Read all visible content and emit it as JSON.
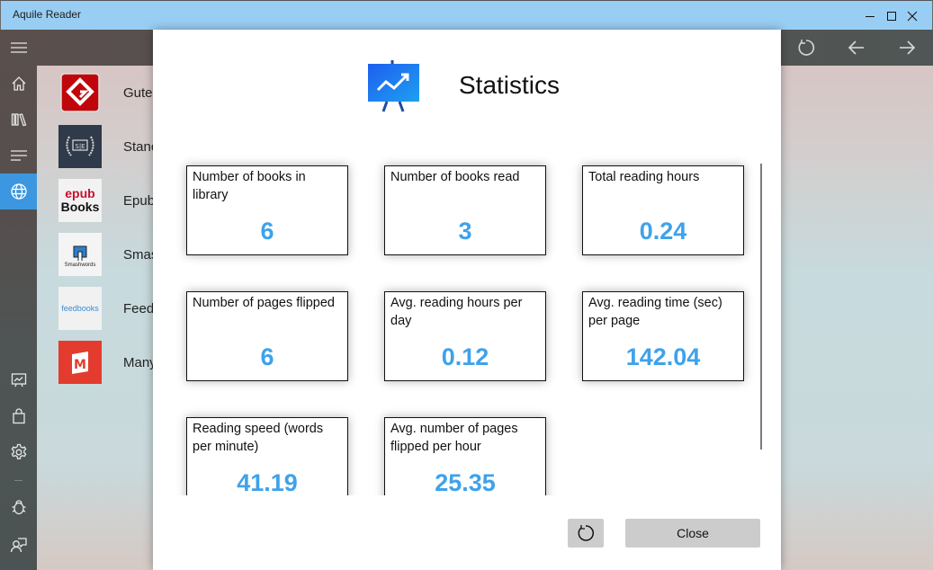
{
  "window": {
    "title": "Aquile Reader",
    "controls": {
      "minimize": "minimize-icon",
      "maximize": "maximize-icon",
      "close": "close-icon"
    }
  },
  "topbar": {
    "buttons": [
      {
        "icon": "refresh-icon"
      },
      {
        "icon": "arrow-left-icon"
      },
      {
        "icon": "arrow-right-icon"
      }
    ]
  },
  "sidebar": {
    "items": [
      {
        "icon": "hamburger-menu-icon"
      },
      {
        "icon": "home-icon"
      },
      {
        "icon": "library-icon"
      },
      {
        "icon": "list-icon"
      },
      {
        "icon": "globe-icon",
        "active": true
      },
      {
        "icon": "statistics-icon"
      },
      {
        "icon": "store-bag-icon"
      },
      {
        "icon": "gear-icon"
      },
      {
        "icon": "bug-icon"
      },
      {
        "icon": "feedback-icon"
      }
    ]
  },
  "catalogs": [
    {
      "name": "Gutenberg",
      "visible_text": "Gute",
      "logo": "gutenberg-logo"
    },
    {
      "name": "Standard Ebooks",
      "visible_text": "Stanc",
      "logo": "standard-ebooks-logo"
    },
    {
      "name": "Epub Books",
      "visible_text": "Epub",
      "logo": "epub-books-logo",
      "logo_text_top": "epub",
      "logo_text_bottom": "Books"
    },
    {
      "name": "Smashwords",
      "visible_text": "Smas",
      "logo": "smashwords-logo",
      "logo_text": "Smashwords"
    },
    {
      "name": "Feedbooks",
      "visible_text": "Feed",
      "logo": "feedbooks-logo",
      "logo_text": "feedbooks"
    },
    {
      "name": "Manybooks",
      "visible_text": "Many",
      "logo": "manybooks-logo",
      "logo_text": "M"
    }
  ],
  "dialog": {
    "title": "Statistics",
    "icon": "statistics-chart-icon",
    "stats": [
      {
        "label": "Number of books in library",
        "value": "6"
      },
      {
        "label": "Number of books read",
        "value": "3"
      },
      {
        "label": "Total reading hours",
        "value": "0.24"
      },
      {
        "label": "Number of pages flipped",
        "value": "6"
      },
      {
        "label": "Avg. reading hours per day",
        "value": "0.12"
      },
      {
        "label": "Avg. reading time (sec) per page",
        "value": "142.04"
      },
      {
        "label": "Reading speed (words per minute)",
        "value": "41.19"
      },
      {
        "label": "Avg. number of pages flipped per hour",
        "value": "25.35"
      }
    ],
    "refresh_icon": "refresh-icon",
    "close_label": "Close"
  },
  "colors": {
    "accent": "#3d97e0",
    "value_text": "#3fa2ea",
    "titlebar": "#99cef4",
    "button": "#cccccc"
  }
}
